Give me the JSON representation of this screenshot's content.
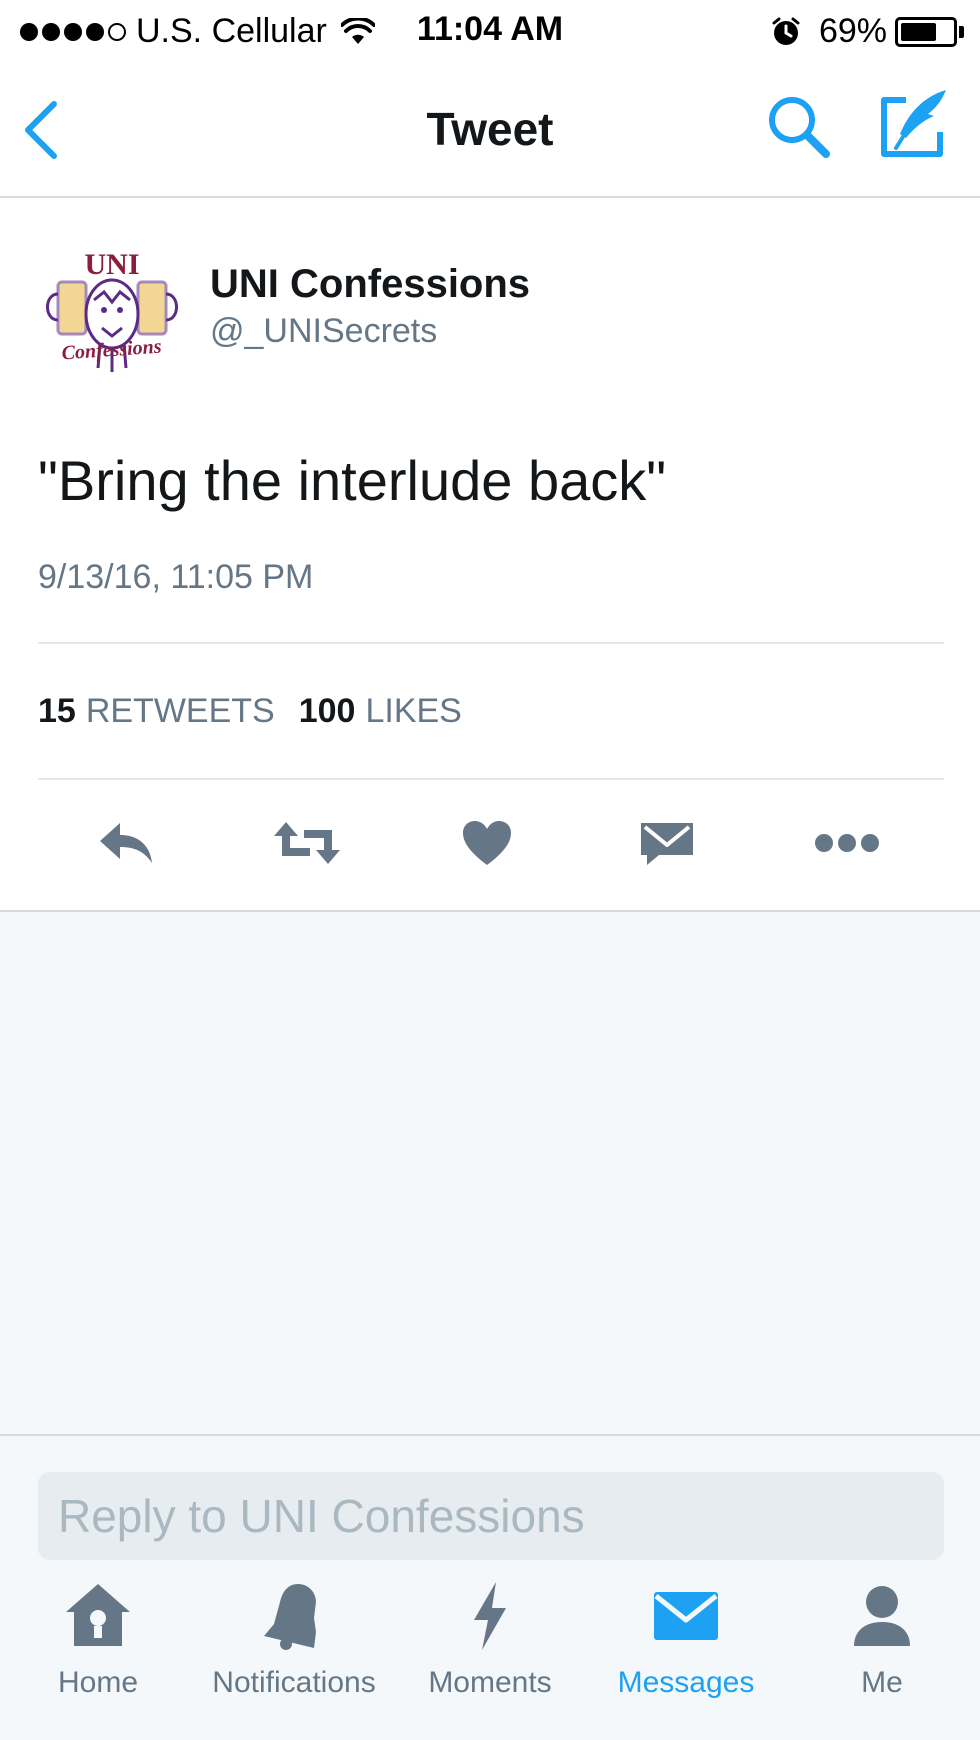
{
  "status_bar": {
    "carrier": "U.S. Cellular",
    "time": "11:04 AM",
    "battery": "69%",
    "battery_level": 0.69,
    "signal_bars": 4,
    "signal_total": 5
  },
  "nav": {
    "title": "Tweet",
    "back_icon": "chevron-left-icon",
    "search_icon": "search-icon",
    "compose_icon": "compose-icon"
  },
  "tweet": {
    "user_name": "UNI Confessions",
    "user_handle": "@_UNISecrets",
    "avatar_text_top": "UNI",
    "avatar_text_bottom": "Confessions",
    "text": "\"Bring the interlude back\"",
    "timestamp": "9/13/16, 11:05 PM",
    "retweets_count": "15",
    "retweets_label": "RETWEETS",
    "likes_count": "100",
    "likes_label": "LIKES"
  },
  "actions": [
    "reply-icon",
    "retweet-icon",
    "like-icon",
    "direct-message-icon",
    "more-icon"
  ],
  "reply": {
    "placeholder": "Reply to UNI Confessions"
  },
  "tabs": [
    {
      "label": "Home",
      "icon": "home-icon",
      "active": false
    },
    {
      "label": "Notifications",
      "icon": "bell-icon",
      "active": false
    },
    {
      "label": "Moments",
      "icon": "lightning-icon",
      "active": false
    },
    {
      "label": "Messages",
      "icon": "envelope-icon",
      "active": true
    },
    {
      "label": "Me",
      "icon": "person-icon",
      "active": false
    }
  ],
  "colors": {
    "accent": "#1da1f2",
    "icon_gray": "#657786",
    "text": "#14171a",
    "background_gray": "#f5f8fa",
    "avatar_purple": "#5b2a86",
    "avatar_gold": "#e8b53b"
  }
}
